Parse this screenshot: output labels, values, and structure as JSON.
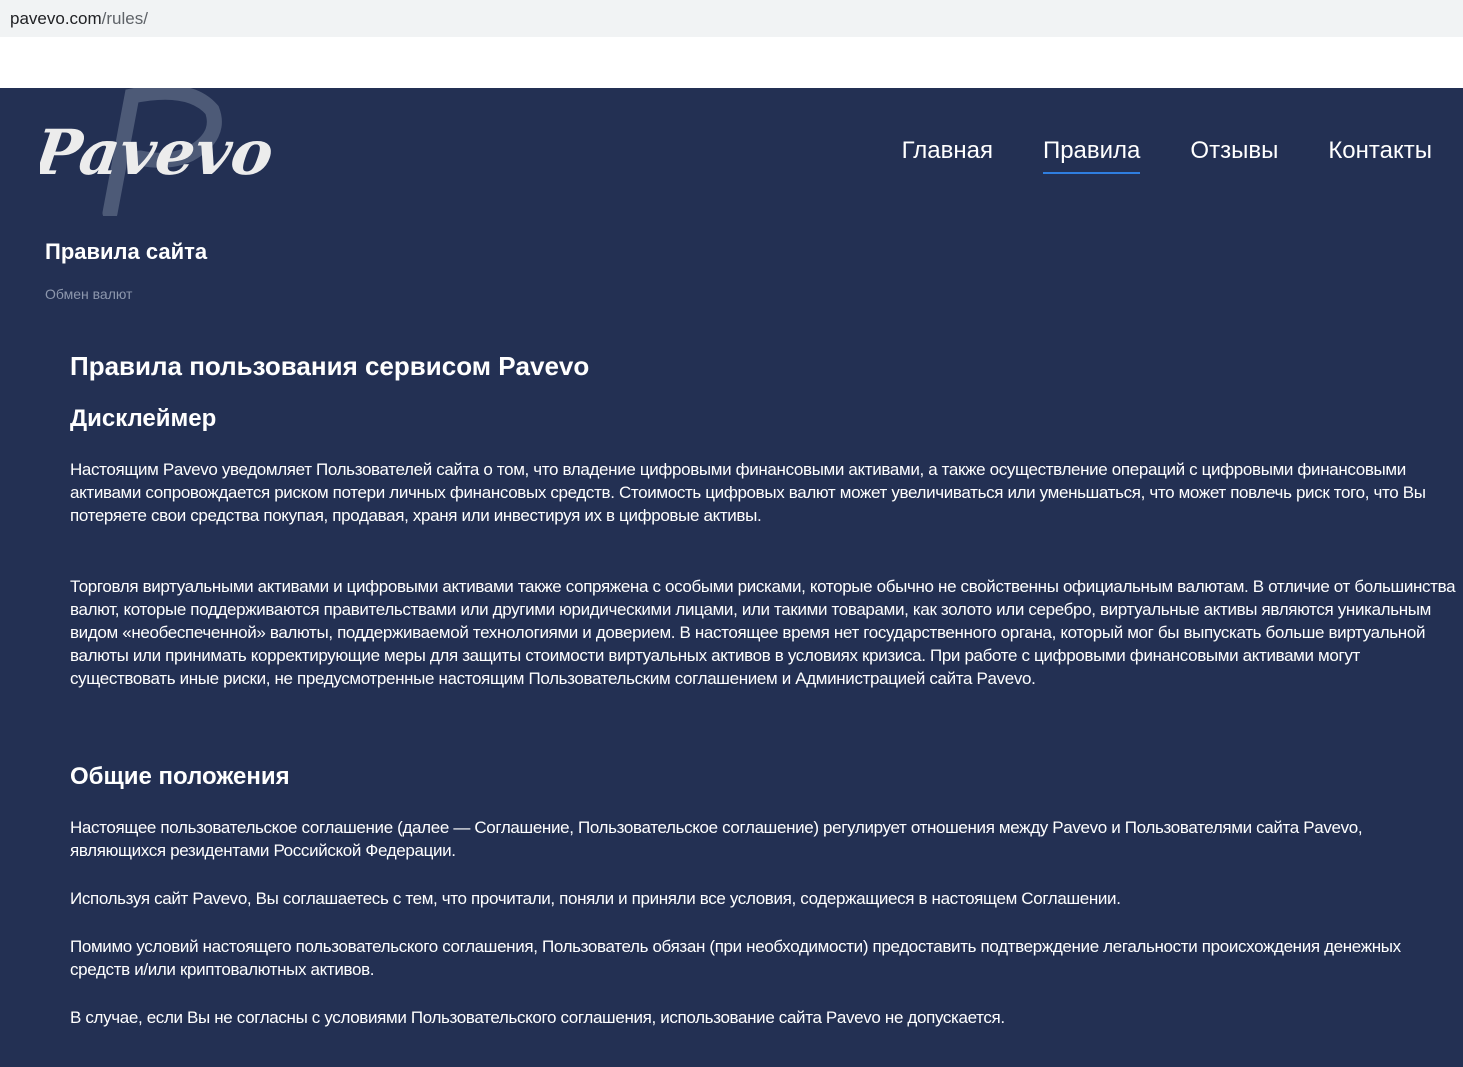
{
  "browser": {
    "url_host": "pavevo.com",
    "url_path": "/rules/"
  },
  "header": {
    "logo_text": "Pavevo",
    "nav": [
      {
        "label": "Главная",
        "active": false
      },
      {
        "label": "Правила",
        "active": true
      },
      {
        "label": "Отзывы",
        "active": false
      },
      {
        "label": "Контакты",
        "active": false
      }
    ]
  },
  "page": {
    "title": "Правила сайта",
    "breadcrumb": "Обмен валют"
  },
  "content": {
    "heading": "Правила пользования сервисом Pavevo",
    "disclaimer": {
      "heading": "Дисклеймер",
      "paragraphs": [
        "Настоящим Pavevo уведомляет Пользователей сайта о том, что владение цифровыми финансовыми активами, а также осуществление операций с цифровыми финансовыми активами сопровождается риском потери личных финансовых средств. Стоимость цифровых валют может увеличиваться или уменьшаться, что может повлечь риск того, что Вы потеряете свои средства покупая, продавая, храня или инвестируя их в цифровые активы.",
        "Торговля виртуальными активами и цифровыми активами также сопряжена с особыми рисками, которые обычно не свойственны официальным валютам. В отличие от большинства валют, которые поддерживаются правительствами или другими юридическими лицами, или такими товарами, как золото или серебро, виртуальные активы являются уникальным видом «необеспеченной» валюты, поддерживаемой технологиями и доверием. В настоящее время нет государственного органа, который мог бы выпускать больше виртуальной валюты или принимать корректирующие меры для защиты стоимости виртуальных активов в условиях кризиса. При работе с цифровыми финансовыми активами могут существовать иные риски, не предусмотренные настоящим Пользовательским соглашением и Администрацией сайта Pavevo."
      ]
    },
    "general": {
      "heading": "Общие положения",
      "paragraphs": [
        "Настоящее пользовательское соглашение (далее — Соглашение, Пользовательское соглашение) регулирует отношения между Pavevo и Пользователями сайта Pavevo, являющихся резидентами Российской Федерации.",
        "Используя сайт Pavevo, Вы соглашаетесь с тем, что прочитали, поняли и приняли все условия, содержащиеся в настоящем Соглашении.",
        "Помимо условий настоящего пользовательского соглашения, Пользователь обязан (при необходимости) предоставить подтверждение легальности происхождения денежных средств и/или криптовалютных активов.",
        "В случае, если Вы не согласны с условиями Пользовательского соглашения, использование сайта Pavevo не допускается."
      ]
    }
  },
  "colors": {
    "background": "#233053",
    "nav_active_underline": "#2f7ee0",
    "breadcrumb": "#8d97ad"
  }
}
